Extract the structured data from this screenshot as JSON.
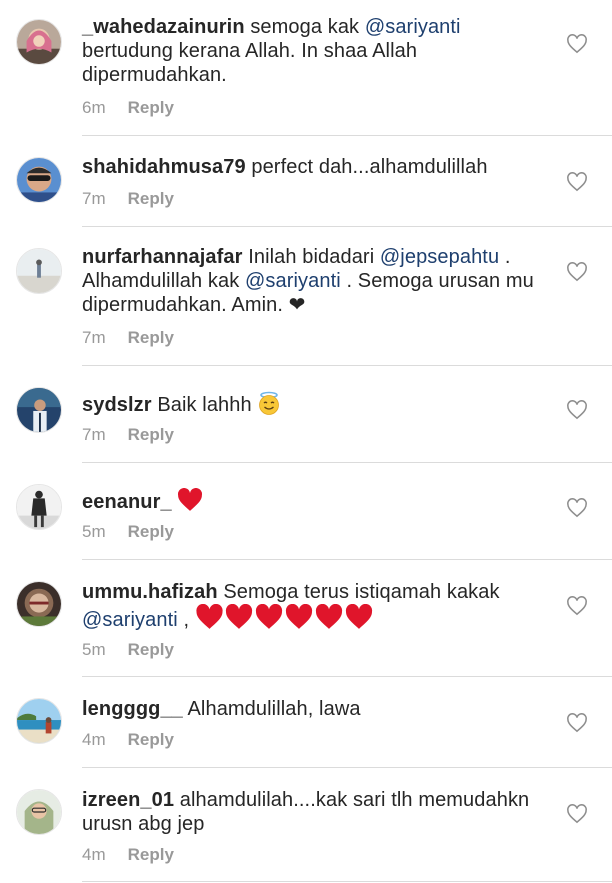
{
  "comments": [
    {
      "username": "_wahedazainurin",
      "segments": [
        {
          "t": "semoga kak ",
          "m": false
        },
        {
          "t": "@sariyanti",
          "m": true
        },
        {
          "t": " bertudung kerana Allah. In shaa Allah dipermudahkan.",
          "m": false
        }
      ],
      "time": "6m",
      "reply": "Reply",
      "avatar": "avatar-hijab-photo"
    },
    {
      "username": "shahidahmusa79",
      "segments": [
        {
          "t": "perfect dah...alhamdulillah",
          "m": false
        }
      ],
      "time": "7m",
      "reply": "Reply",
      "avatar": "avatar-sunglasses-photo"
    },
    {
      "username": "nurfarhannajafar",
      "segments": [
        {
          "t": "Inilah bidadari ",
          "m": false
        },
        {
          "t": "@jepsepahtu",
          "m": true
        },
        {
          "t": " . Alhamdulillah kak ",
          "m": false
        },
        {
          "t": "@sariyanti",
          "m": true
        },
        {
          "t": " . Semoga urusan mu dipermudahkan. Amin. ❤",
          "m": false
        }
      ],
      "time": "7m",
      "reply": "Reply",
      "avatar": "avatar-beach-photo"
    },
    {
      "username": "sydslzr",
      "segments": [
        {
          "t": "Baik lahhh",
          "m": false
        }
      ],
      "emoji": [
        "halo-emoji"
      ],
      "time": "7m",
      "reply": "Reply",
      "avatar": "avatar-man-photo"
    },
    {
      "username": "eenanur_",
      "segments": [],
      "emoji": [
        "heart-emoji"
      ],
      "time": "5m",
      "reply": "Reply",
      "avatar": "avatar-walking-photo"
    },
    {
      "username": "ummu.hafizah",
      "segments": [
        {
          "t": "Semoga terus istiqamah kakak ",
          "m": false
        },
        {
          "t": "@sariyanti",
          "m": true
        },
        {
          "t": " , ",
          "m": false
        }
      ],
      "emoji": [
        "heart-emoji",
        "heart-emoji",
        "heart-emoji",
        "heart-emoji",
        "heart-emoji",
        "heart-emoji"
      ],
      "time": "5m",
      "reply": "Reply",
      "avatar": "avatar-emblem-photo"
    },
    {
      "username": "lengggg__",
      "segments": [
        {
          "t": "Alhamdulillah, lawa",
          "m": false
        }
      ],
      "time": "4m",
      "reply": "Reply",
      "avatar": "avatar-seaside-photo"
    },
    {
      "username": "izreen_01",
      "segments": [
        {
          "t": "alhamdulilah....kak sari tlh memudahkn urusn abg jep",
          "m": false
        }
      ],
      "time": "4m",
      "reply": "Reply",
      "avatar": "avatar-glasses-photo"
    }
  ],
  "colors": {
    "mention": "#1e3f6e",
    "meta": "#999999",
    "divider": "#dbdbdb",
    "heart": "#e0152b"
  }
}
